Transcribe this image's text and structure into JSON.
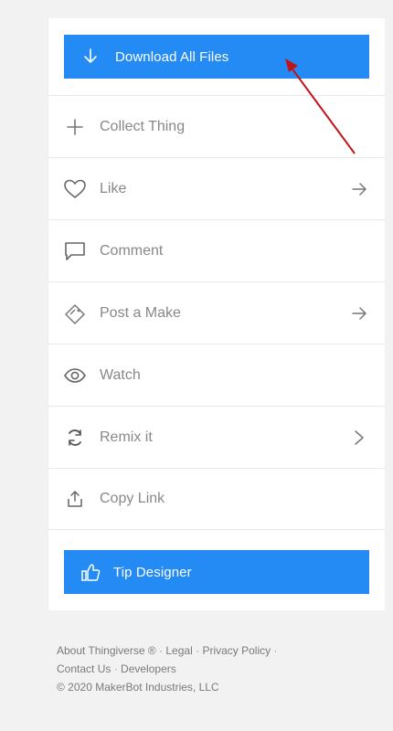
{
  "download_button": {
    "label": "Download All Files",
    "icon": "download-arrow-icon"
  },
  "menu": {
    "items": [
      {
        "label": "Collect Thing",
        "icon": "plus-icon",
        "has_arrow": false
      },
      {
        "label": "Like",
        "icon": "heart-icon",
        "has_arrow": true
      },
      {
        "label": "Comment",
        "icon": "comment-icon",
        "has_arrow": false
      },
      {
        "label": "Post a Make",
        "icon": "make-tag-icon",
        "has_arrow": true
      },
      {
        "label": "Watch",
        "icon": "eye-icon",
        "has_arrow": false
      },
      {
        "label": "Remix it",
        "icon": "remix-icon",
        "has_arrow": true
      },
      {
        "label": "Copy Link",
        "icon": "share-icon",
        "has_arrow": false
      }
    ]
  },
  "tip_button": {
    "label": "Tip Designer",
    "icon": "thumbs-up-icon"
  },
  "footer": {
    "links": [
      "About Thingiverse ®",
      "Legal",
      "Privacy Policy",
      "Contact Us",
      "Developers"
    ],
    "separator": "·",
    "copyright": "© 2020 MakerBot Industries, LLC"
  },
  "colors": {
    "accent": "#248bf5",
    "annotation_arrow": "#c0131a",
    "menu_text": "#888888",
    "background": "#f2f2f2"
  }
}
